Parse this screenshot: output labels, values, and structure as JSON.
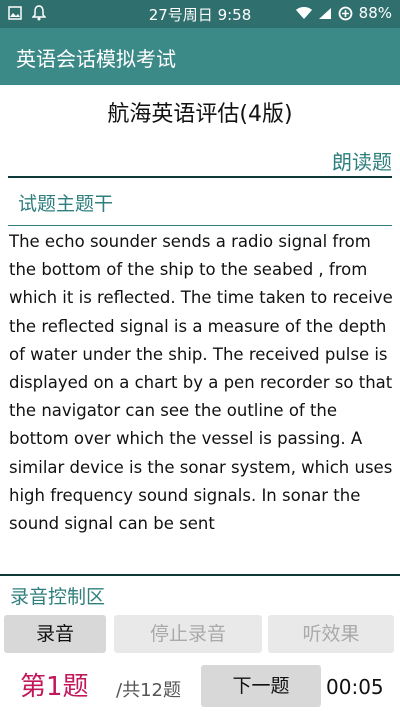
{
  "status_bar": {
    "time": "27号周日 9:58",
    "battery": "88%",
    "icons": [
      "image-icon",
      "notification-icon",
      "wifi-icon",
      "signal-icon",
      "battery-saver-icon"
    ]
  },
  "app_bar": {
    "title": "英语会话模拟考试"
  },
  "exam": {
    "title": "航海英语评估(4版)",
    "section_type": "朗读题",
    "stem_label": "试题主题干",
    "passage": "The echo sounder sends a radio signal from the bottom of the ship to the seabed , from which it is reflected. The time taken to receive the reflected signal is a measure of the depth of water under the ship. The received pulse is displayed on a chart by a pen recorder so that the navigator can see the outline of the bottom over which the vessel is passing. A similar device is the sonar system, which uses high frequency sound signals. In sonar the sound signal can be sent"
  },
  "recording": {
    "label": "录音控制区",
    "record_button": "录音",
    "stop_button": "停止录音",
    "listen_button": "听效果"
  },
  "footer": {
    "question_number": "第1题",
    "question_total": "/共12题",
    "next_button": "下一题",
    "timer": "00:05"
  },
  "colors": {
    "status_bar": "#2f6f6e",
    "app_bar": "#3c8a88",
    "accent": "#2f7f7e",
    "question_number": "#c2185b"
  }
}
